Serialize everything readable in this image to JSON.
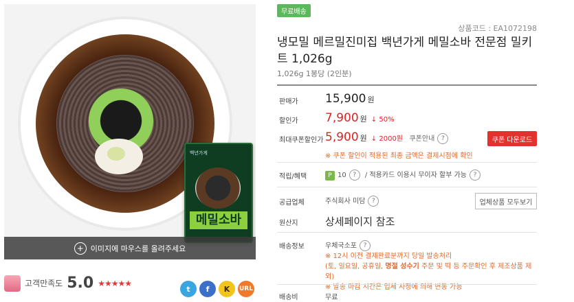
{
  "gallery": {
    "hover_text": "이미지에 마우스를 올려주세요",
    "package_title": "메밀소바",
    "package_brand": "백년가게"
  },
  "rating": {
    "label": "고객만족도",
    "score": "5.0",
    "stars": "★★★★★",
    "value": 5.0
  },
  "share": {
    "twitter": "t",
    "facebook": "f",
    "kakao": "K",
    "url": "URL"
  },
  "product": {
    "badge": "무료배송",
    "code": "상품코드 : EA1072198",
    "title": "냉모밀 메르밀진미집 백년가게 메밀소바 전문점 밀키트 1,026g",
    "subtitle": "1,026g 1봉당 (2인분)"
  },
  "prices": {
    "sale_label": "판매가",
    "sale_price": "15,900",
    "won": "원",
    "discount_label": "할인가",
    "discount_price": "7,900",
    "discount_rate": "↓ 50%",
    "coupon_label": "최대쿠폰할인가",
    "coupon_price": "5,900",
    "coupon_amount": "↓ 2000원",
    "coupon_info": "쿠폰안내",
    "coupon_button": "쿠폰 다운로드",
    "coupon_notice": "※ 쿠폰 할인이 적용된 최종 금액은 결제시점에 확인"
  },
  "benefits": {
    "label": "적립/혜택",
    "points": "10",
    "card": "/ 적용카드 이용시 무이자 할부 가능"
  },
  "supplier": {
    "label": "공급업체",
    "name": "주식회사 미담",
    "button": "업체상품 모두보기"
  },
  "origin": {
    "label": "원산지",
    "value": "상세페이지 참조"
  },
  "shipping": {
    "label": "배송정보",
    "method": "우체국소포",
    "line1": "※ 12시 이전 결제완료분까지 당일 발송처리",
    "line2a": "(토, 일요일, 공휴일, ",
    "line2b": "명절 성수기",
    "line2c": " 주문 및 떡 등 주문확인 후 제조상품 제외)",
    "line3": "※ 발송 마감 시간은 업체 사정에 의해 변동 가능"
  },
  "fee": {
    "label": "배송비",
    "value": "무료"
  },
  "q": "?"
}
